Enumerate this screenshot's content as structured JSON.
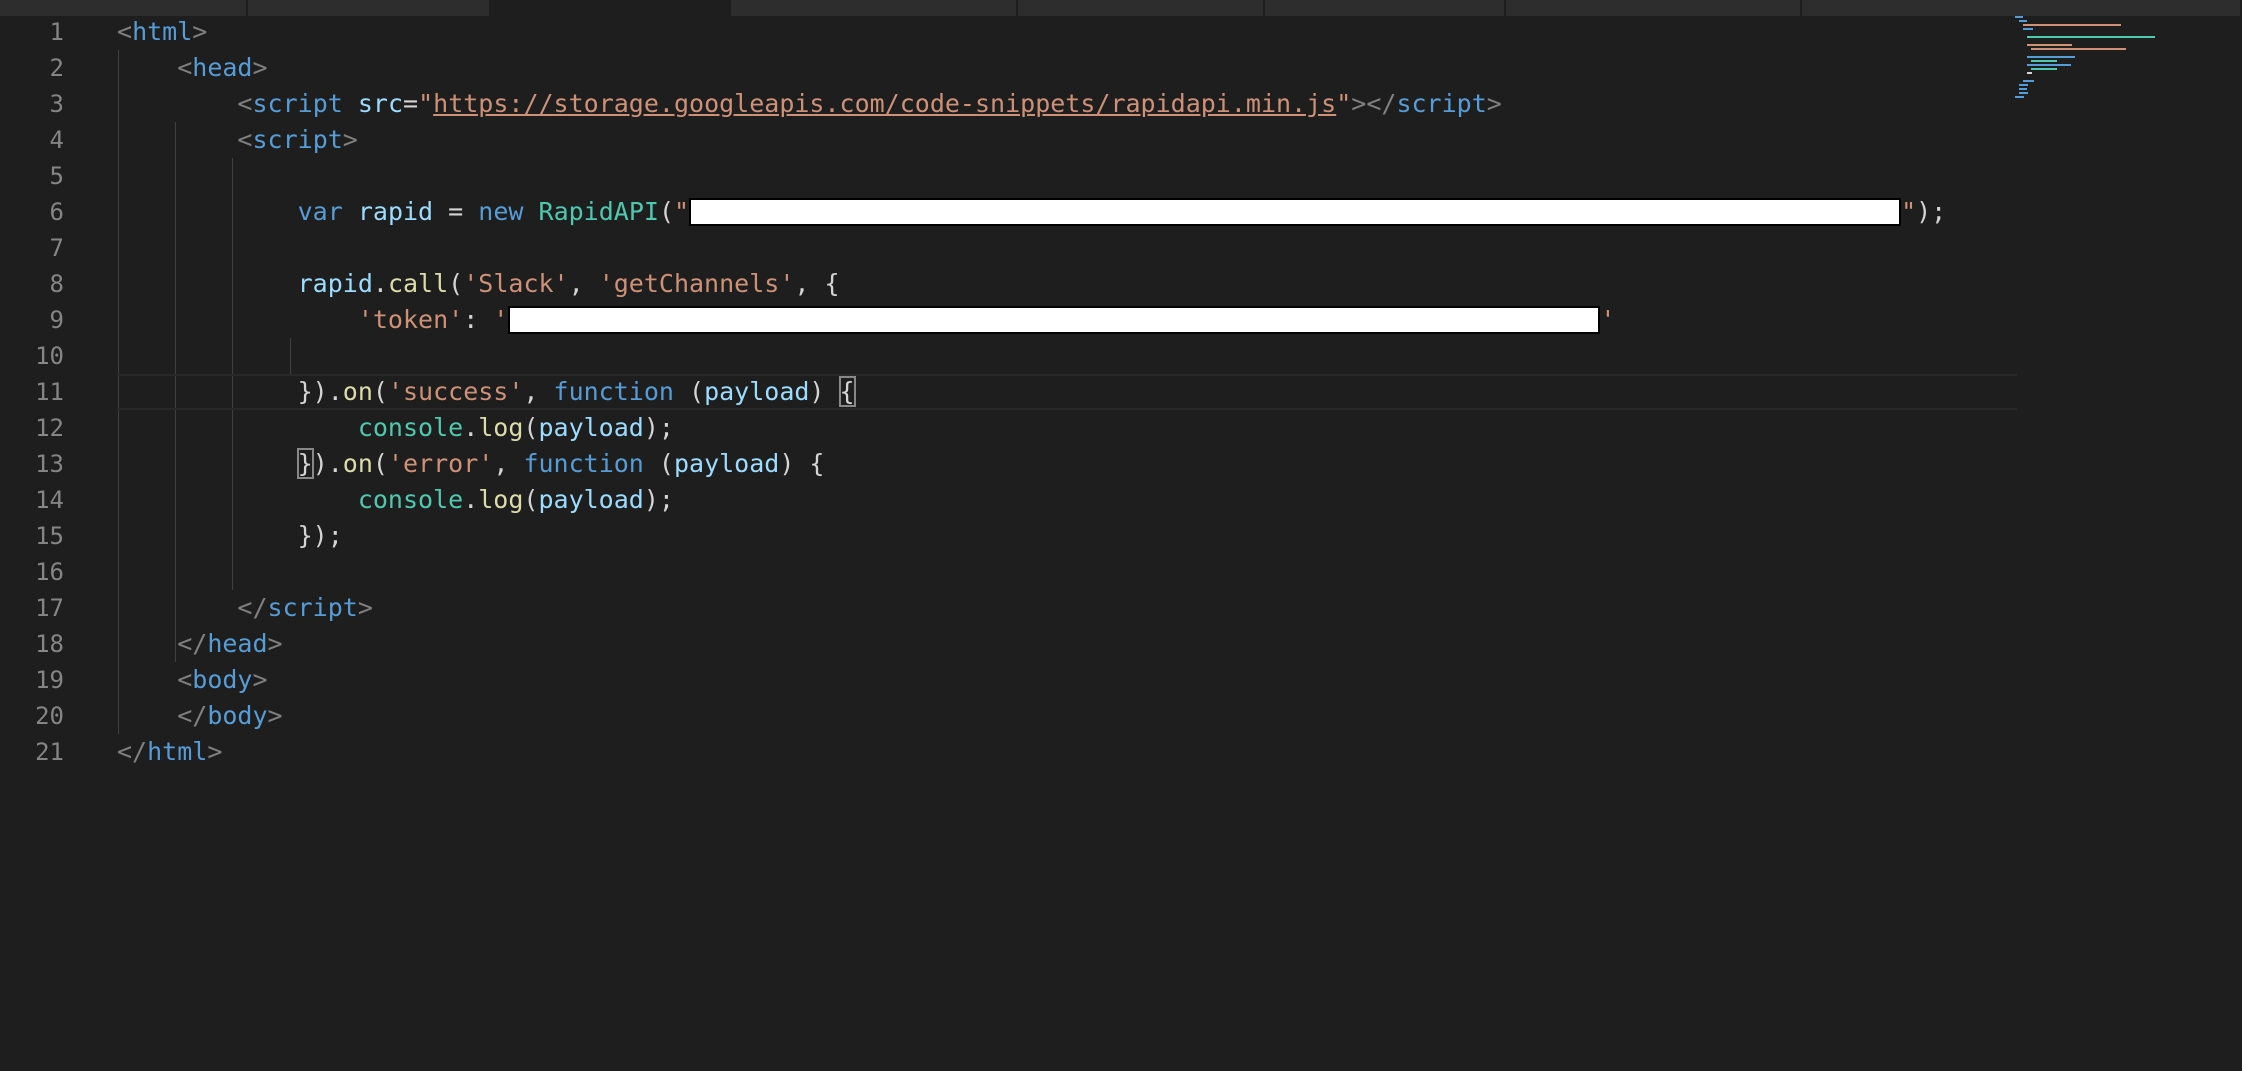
{
  "editor": {
    "tabs": [
      "",
      "",
      "",
      "",
      "",
      "",
      "",
      ""
    ],
    "line_numbers": [
      "1",
      "2",
      "3",
      "4",
      "5",
      "6",
      "7",
      "8",
      "9",
      "10",
      "11",
      "12",
      "13",
      "14",
      "15",
      "16",
      "17",
      "18",
      "19",
      "20",
      "21"
    ],
    "code": {
      "l1": {
        "open": "<",
        "tag": "html",
        "close": ">"
      },
      "l2": {
        "open": "<",
        "tag": "head",
        "close": ">"
      },
      "l3": {
        "open": "<",
        "tag": "script",
        "attr": "src",
        "eq": "=",
        "q1": "\"",
        "url": "https://storage.googleapis.com/code-snippets/rapidapi.min.js",
        "q2": "\"",
        "mid": "></",
        "tag2": "script",
        "close": ">"
      },
      "l4": {
        "open": "<",
        "tag": "script",
        "close": ">"
      },
      "l6": {
        "kw_var": "var",
        "name": "rapid",
        "eq": "=",
        "kw_new": "new",
        "cls": "RapidAPI",
        "paren_open": "(",
        "q1": "\"",
        "redacted": "[redacted]",
        "q2": "\"",
        "end": ");"
      },
      "l8": {
        "obj": "rapid",
        "dot": ".",
        "fn": "call",
        "paren": "(",
        "arg1": "'Slack'",
        "comma1": ", ",
        "arg2": "'getChannels'",
        "rest": ", {"
      },
      "l9": {
        "key": "'token'",
        "colon": ": ",
        "q1": "'",
        "redacted": "[redacted]",
        "q2": "'"
      },
      "l11": {
        "pre": "}).",
        "fn": "on",
        "paren": "(",
        "arg": "'success'",
        "comma": ", ",
        "kw": "function",
        "sp": " (",
        "param": "payload",
        "close": ") ",
        "brace": "{"
      },
      "l12": {
        "obj": "console",
        "dot": ".",
        "fn": "log",
        "paren": "(",
        "arg": "payload",
        "end": ");"
      },
      "l13": {
        "brace": "}",
        "pre": ").",
        "fn": "on",
        "paren": "(",
        "arg": "'error'",
        "comma": ", ",
        "kw": "function",
        "sp": " (",
        "param": "payload",
        "close": ") {"
      },
      "l14": {
        "obj": "console",
        "dot": ".",
        "fn": "log",
        "paren": "(",
        "arg": "payload",
        "end": ");"
      },
      "l15": {
        "text": "});"
      },
      "l17": {
        "open": "</",
        "tag": "script",
        "close": ">"
      },
      "l18": {
        "open": "</",
        "tag": "head",
        "close": ">"
      },
      "l19": {
        "open": "<",
        "tag": "body",
        "close": ">"
      },
      "l20": {
        "open": "</",
        "tag": "body",
        "close": ">"
      },
      "l21": {
        "open": "</",
        "tag": "html",
        "close": ">"
      }
    }
  },
  "colors": {
    "background": "#1e1e1e",
    "tag": "#569cd6",
    "string": "#ce9178",
    "variable": "#9cdcfe",
    "class": "#4ec9b0",
    "function": "#dcdcaa",
    "line_number": "#858585"
  }
}
